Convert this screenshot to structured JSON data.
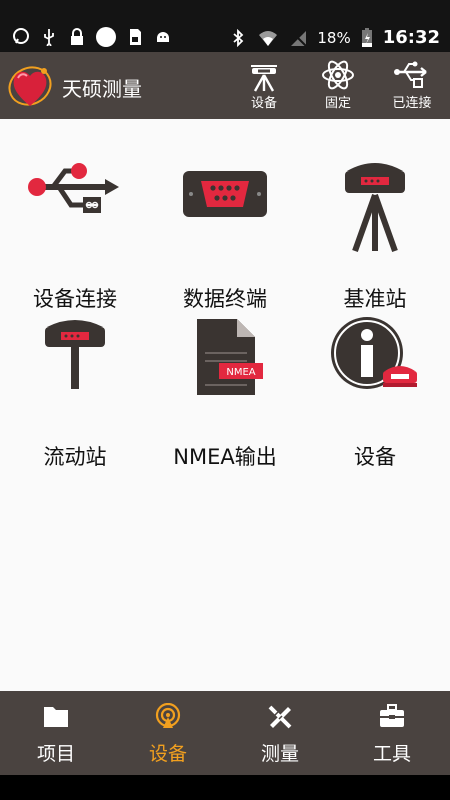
{
  "status_bar": {
    "battery": "18%",
    "time": "16:32"
  },
  "app": {
    "title": "天硕测量",
    "header_actions": [
      {
        "label": "设备",
        "icon": "receiver-icon"
      },
      {
        "label": "固定",
        "icon": "atom-icon"
      },
      {
        "label": "已连接",
        "icon": "usb-connected-icon"
      }
    ]
  },
  "grid": {
    "items": [
      {
        "label": "设备连接",
        "icon": "usb-icon"
      },
      {
        "label": "数据终端",
        "icon": "serial-port-icon"
      },
      {
        "label": "基准站",
        "icon": "base-station-icon"
      },
      {
        "label": "流动站",
        "icon": "rover-icon"
      },
      {
        "label": "NMEA输出",
        "icon": "nmea-file-icon"
      },
      {
        "label": "设备",
        "icon": "device-info-icon"
      }
    ],
    "nmea_badge": "NMEA"
  },
  "bottom_nav": {
    "items": [
      {
        "label": "项目",
        "icon": "folder-icon"
      },
      {
        "label": "设备",
        "icon": "antenna-icon",
        "active": true
      },
      {
        "label": "测量",
        "icon": "survey-tools-icon"
      },
      {
        "label": "工具",
        "icon": "toolbox-icon"
      }
    ]
  },
  "colors": {
    "header_bg": "#4a4340",
    "active": "#f2a01f",
    "accent_red": "#d8213a",
    "icon_dark": "#3a3431"
  }
}
